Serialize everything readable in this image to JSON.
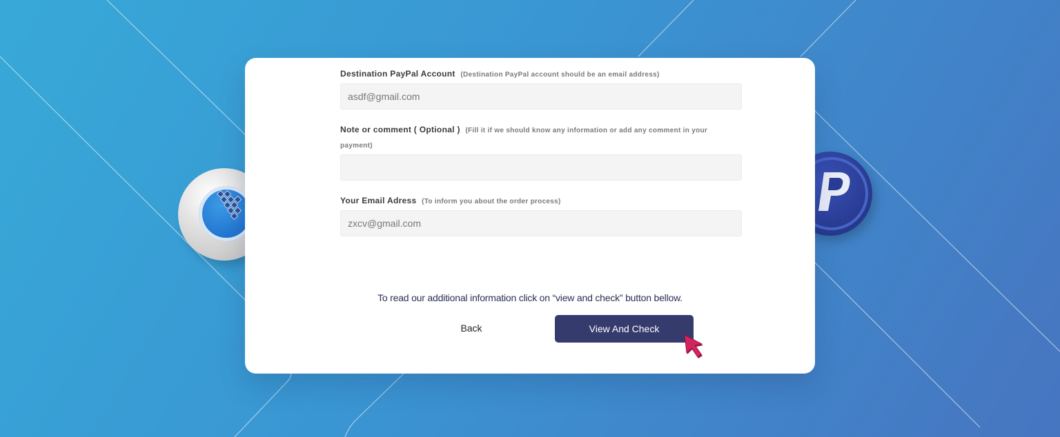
{
  "form": {
    "paypal_label": "Destination PayPal Account",
    "paypal_hint": "(Destination PayPal account should be an email address)",
    "paypal_value": "asdf@gmail.com",
    "note_label": "Note or comment ( Optional )",
    "note_hint": "(Fill it if we should know any information or add any comment in your payment)",
    "note_value": "",
    "email_label": "Your Email Adress",
    "email_hint": "(To inform you about the order process)",
    "email_value": "zxcv@gmail.com"
  },
  "info_text": "To read our additional information click on “view and check” button bellow.",
  "actions": {
    "back_label": "Back",
    "view_label": "View And Check"
  },
  "colors": {
    "primary_button": "#363b6e",
    "background_start": "#37a9d8",
    "background_end": "#4775c0",
    "cursor": "#c2185b"
  },
  "icons": {
    "left_coin": "crypto-coin-icon",
    "right_coin": "paypal-coin-icon",
    "pointer": "mouse-pointer-icon"
  }
}
